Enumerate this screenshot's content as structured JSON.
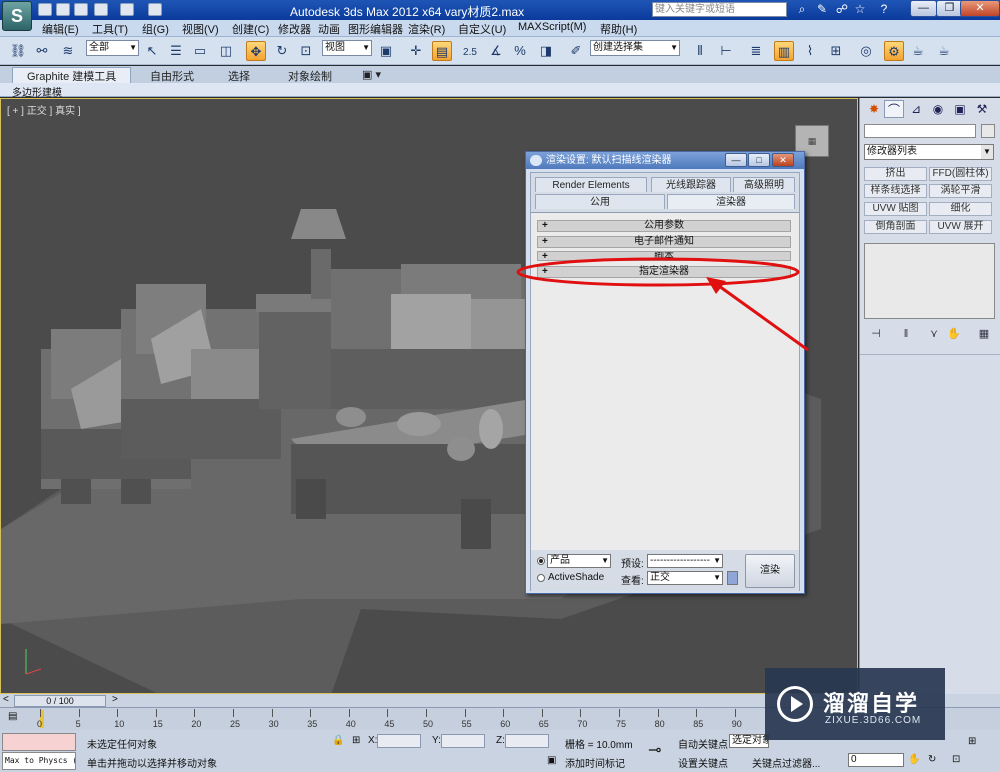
{
  "titlebar": {
    "logo_text": "S",
    "title": "Autodesk 3ds Max  2012 x64       vary材质2.max",
    "search_placeholder": "键入关键字或短语",
    "window_buttons": [
      "—",
      "❐",
      "✕"
    ]
  },
  "menu": [
    "编辑(E)",
    "工具(T)",
    "组(G)",
    "视图(V)",
    "创建(C)",
    "修改器",
    "动画",
    "图形编辑器",
    "渲染(R)",
    "自定义(U)",
    "MAXScript(M)",
    "帮助(H)"
  ],
  "toolbar": {
    "selection_filter": "全部",
    "reference_coord": "视图",
    "named_selection": "创建选择集",
    "snap_label": "2.5"
  },
  "ribbon": {
    "tabs": [
      "Graphite 建模工具",
      "自由形式",
      "选择",
      "对象绘制"
    ],
    "sub_label": "多边形建模"
  },
  "viewport": {
    "label": "[ + ] 正交 ] 真实 ]"
  },
  "dialog": {
    "title": "渲染设置: 默认扫描线渲染器",
    "tabs_row1": [
      "Render Elements",
      "光线跟踪器",
      "高级照明"
    ],
    "tabs_row2": [
      "公用",
      "渲染器"
    ],
    "rollouts": [
      "公用参数",
      "电子邮件通知",
      "脚本",
      "指定渲染器"
    ],
    "mode_options": [
      "产品",
      "ActiveShade"
    ],
    "mode_selected": "产品",
    "preset_label": "预设:",
    "preset_value": "------------------",
    "view_label": "查看:",
    "view_value": "正交",
    "render_button": "渲染"
  },
  "command_panel": {
    "modifier_list": "修改器列表",
    "modifier_buttons": [
      "挤出",
      "FFD(圆柱体)",
      "样条线选择",
      "涡轮平滑",
      "UVW 贴图",
      "细化",
      "倒角剖面",
      "UVW 展开"
    ]
  },
  "timeline": {
    "slider_text": "0 / 100",
    "ticks": [
      "0",
      "5",
      "10",
      "15",
      "20",
      "25",
      "30",
      "35",
      "40",
      "45",
      "50",
      "55",
      "60",
      "65",
      "70",
      "75",
      "80",
      "85",
      "90"
    ]
  },
  "status": {
    "maxscript_text": "Max to Physcs (",
    "prompt1": "未选定任何对象",
    "prompt2": "单击并拖动以选择并移动对象",
    "x_label": "X:",
    "y_label": "Y:",
    "z_label": "Z:",
    "grid": "栅格 = 10.0mm",
    "add_time_tag": "添加时间标记",
    "auto_key": "自动关键点",
    "selected_obj": "选定对象",
    "set_key": "设置关键点",
    "key_filter": "关键点过滤器...",
    "frame": "0"
  },
  "watermark": {
    "title": "溜溜自学",
    "sub": "ZIXUE.3D66.COM"
  },
  "colors": {
    "annotation": "#e01010",
    "viewport_bg": "#4b4b4b"
  }
}
